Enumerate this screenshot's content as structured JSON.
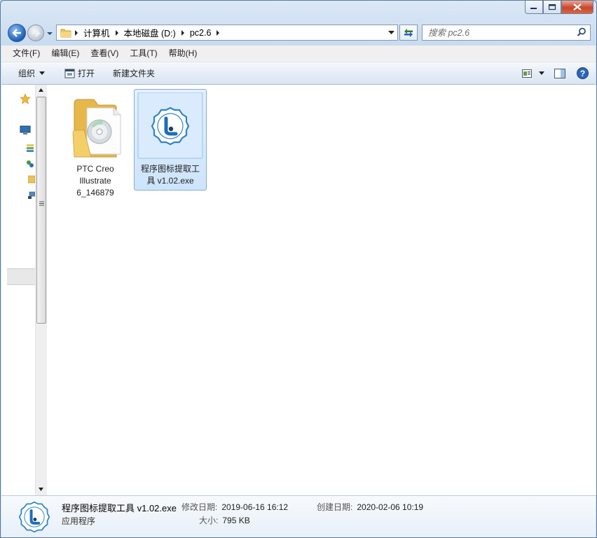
{
  "window": {
    "controls": {
      "minimize": "minimize",
      "maximize": "maximize",
      "close": "close"
    }
  },
  "address": {
    "crumbs": [
      "计算机",
      "本地磁盘 (D:)",
      "pc2.6"
    ]
  },
  "search": {
    "placeholder": "搜索 pc2.6"
  },
  "menu": {
    "items": [
      "文件(F)",
      "编辑(E)",
      "查看(V)",
      "工具(T)",
      "帮助(H)"
    ]
  },
  "toolbar": {
    "organize": "组织",
    "open": "打开",
    "new_folder": "新建文件夹"
  },
  "files": [
    {
      "name": "PTC Creo Illustrate 6_146879",
      "type": "folder",
      "icon": "folder-disc-icon",
      "selected": false
    },
    {
      "name": "程序图标提取工具 v1.02.exe",
      "type": "exe",
      "icon": "app-badge-icon",
      "selected": true
    }
  ],
  "details": {
    "name": "程序图标提取工具 v1.02.exe",
    "type": "应用程序",
    "modified_label": "修改日期:",
    "modified": "2019-06-16 16:12",
    "size_label": "大小:",
    "size": "795 KB",
    "created_label": "创建日期:",
    "created": "2020-02-06 10:19"
  },
  "colors": {
    "accent": "#1d6fb8",
    "selection": "#cde4fb",
    "selection_border": "#84acdd"
  }
}
